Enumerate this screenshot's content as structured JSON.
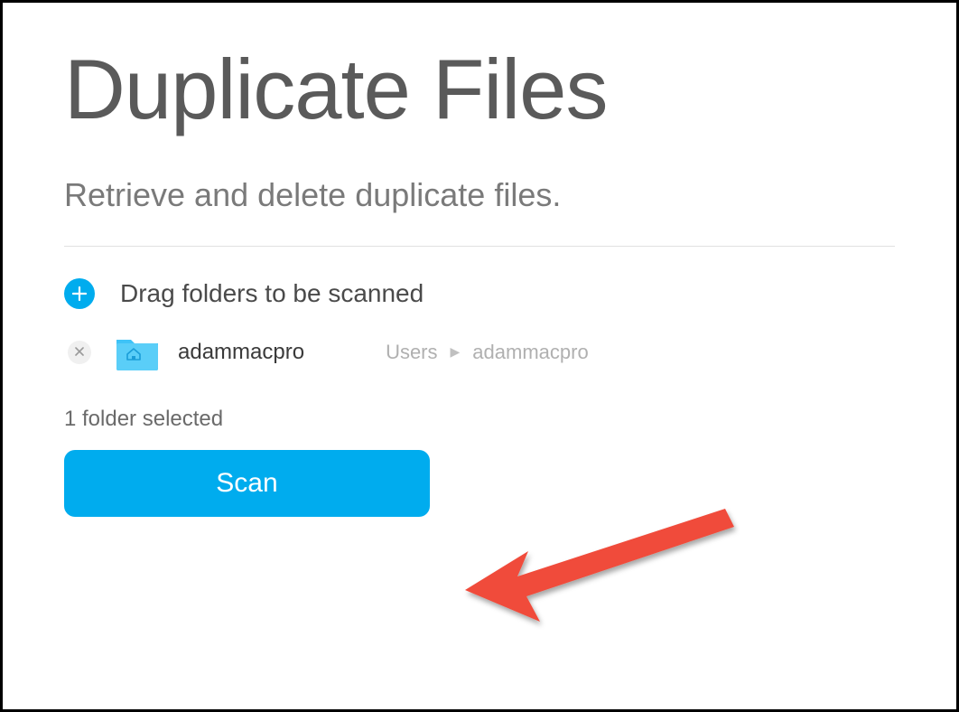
{
  "title": "Duplicate Files",
  "subtitle": "Retrieve and delete duplicate files.",
  "drag_label": "Drag folders to be scanned",
  "folders": [
    {
      "name": "adammacpro",
      "path_parts": [
        "Users",
        "adammacpro"
      ]
    }
  ],
  "status": "1 folder selected",
  "scan_button_label": "Scan",
  "colors": {
    "accent": "#00acee",
    "annotation_arrow": "#f04b3a"
  }
}
